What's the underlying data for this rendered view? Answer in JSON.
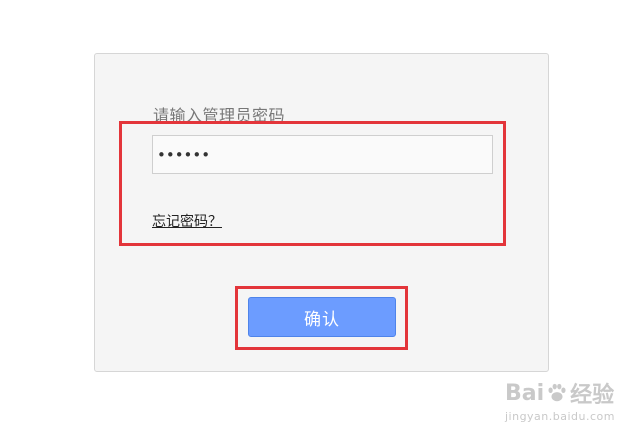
{
  "login": {
    "prompt": "请输入管理员密码",
    "password_value": "••••••",
    "forgot_label": "忘记密码？",
    "confirm_label": "确认"
  },
  "watermark": {
    "brand_left": "Bai",
    "brand_right": "经验",
    "url": "jingyan.baidu.com"
  },
  "colors": {
    "panel_bg": "#f5f5f5",
    "button_bg": "#6c9cff",
    "highlight": "#e3353a"
  },
  "icons": {
    "watermark_logo": "paw-icon"
  }
}
